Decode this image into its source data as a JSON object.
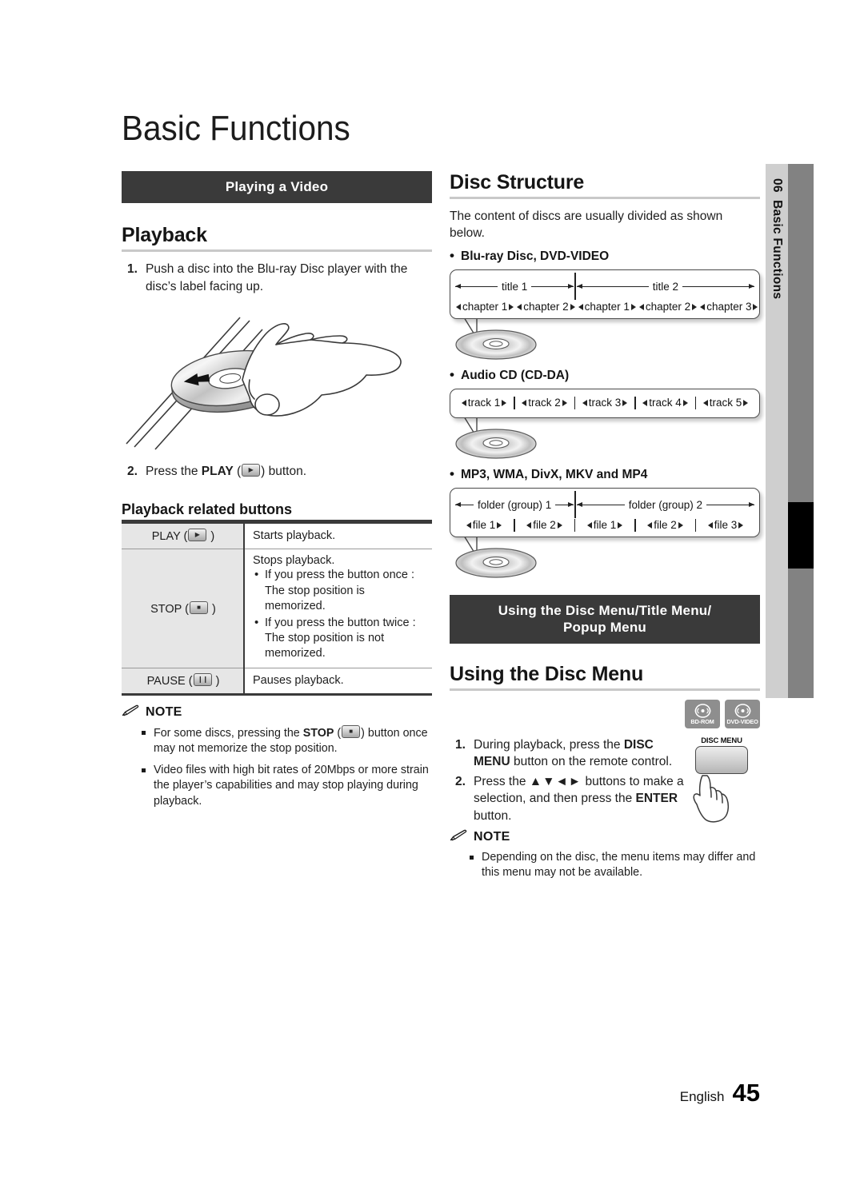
{
  "page": {
    "title": "Basic Functions",
    "footer_language": "English",
    "footer_page_number": "45",
    "side_tab_number": "06",
    "side_tab_label": "Basic Functions",
    "accent_dark": "#3a3a3a",
    "accent_gray": "#8e8e8e",
    "rule_gray": "#c9c9c9"
  },
  "left_column": {
    "banner": "Playing a Video",
    "playback": {
      "heading": "Playback",
      "steps": [
        {
          "num": "1.",
          "text": "Push a disc into the Blu-ray Disc player with the disc’s label facing up."
        },
        {
          "num": "2.",
          "text_before": "Press the ",
          "bold": "PLAY",
          "text_paren_open": " (",
          "icon": "play-key-icon",
          "text_after": ") button."
        }
      ],
      "illustration_name": "insert-disc-illustration"
    },
    "related_buttons": {
      "heading": "Playback related buttons",
      "rows": [
        {
          "key_label": "PLAY",
          "key_icon": "play-key-icon",
          "description": "Starts playback.",
          "bullets": []
        },
        {
          "key_label": "STOP",
          "key_icon": "stop-key-icon",
          "description": "Stops playback.",
          "bullets": [
            "If you press the button once : The stop position is memorized.",
            "If you press the button twice : The stop position is not memorized."
          ]
        },
        {
          "key_label": "PAUSE",
          "key_icon": "pause-key-icon",
          "description": "Pauses playback.",
          "bullets": []
        }
      ]
    },
    "note": {
      "title": "NOTE",
      "items": [
        {
          "before": "For some discs, pressing the ",
          "bold": "STOP",
          "paren_open": " (",
          "icon": "stop-key-icon",
          "after": ") button once may not memorize the stop position."
        },
        {
          "plain": "Video files with high bit rates of 20Mbps or more strain the player’s capabilities and may stop playing during playback."
        }
      ]
    }
  },
  "right_column": {
    "disc_structure": {
      "heading": "Disc Structure",
      "intro": "The content of discs are usually divided as shown below.",
      "groups": [
        {
          "label": "Blu-ray Disc, DVD-VIDEO",
          "titles": [
            "title 1",
            "title 2"
          ],
          "chapters": [
            "chapter 1",
            "chapter 2",
            "chapter 1",
            "chapter 2",
            "chapter 3"
          ]
        },
        {
          "label": "Audio CD (CD-DA)",
          "tracks": [
            "track 1",
            "track 2",
            "track 3",
            "track 4",
            "track 5"
          ]
        },
        {
          "label": "MP3, WMA, DivX, MKV and MP4",
          "folders": [
            "folder (group) 1",
            "folder (group) 2"
          ],
          "files": [
            "file 1",
            "file 2",
            "file 1",
            "file 2",
            "file 3"
          ]
        }
      ]
    },
    "disc_menu": {
      "banner_line1": "Using the Disc Menu/Title Menu/",
      "banner_line2": "Popup Menu",
      "heading": "Using the Disc Menu",
      "badges": [
        "BD-ROM",
        "DVD-VIDEO"
      ],
      "remote_caption": "DISC MENU",
      "steps": [
        {
          "num": "1.",
          "before": "During playback, press the ",
          "bold1": "DISC MENU",
          "after": " button on the remote control."
        },
        {
          "num": "2.",
          "before": "Press the ",
          "arrows": "▲▼◄►",
          "mid": " buttons to make a selection, and then press the ",
          "bold1": "ENTER",
          "after": " button."
        }
      ],
      "note": {
        "title": "NOTE",
        "items": [
          "Depending on the disc, the menu items may differ and this menu may not be available."
        ]
      }
    }
  }
}
